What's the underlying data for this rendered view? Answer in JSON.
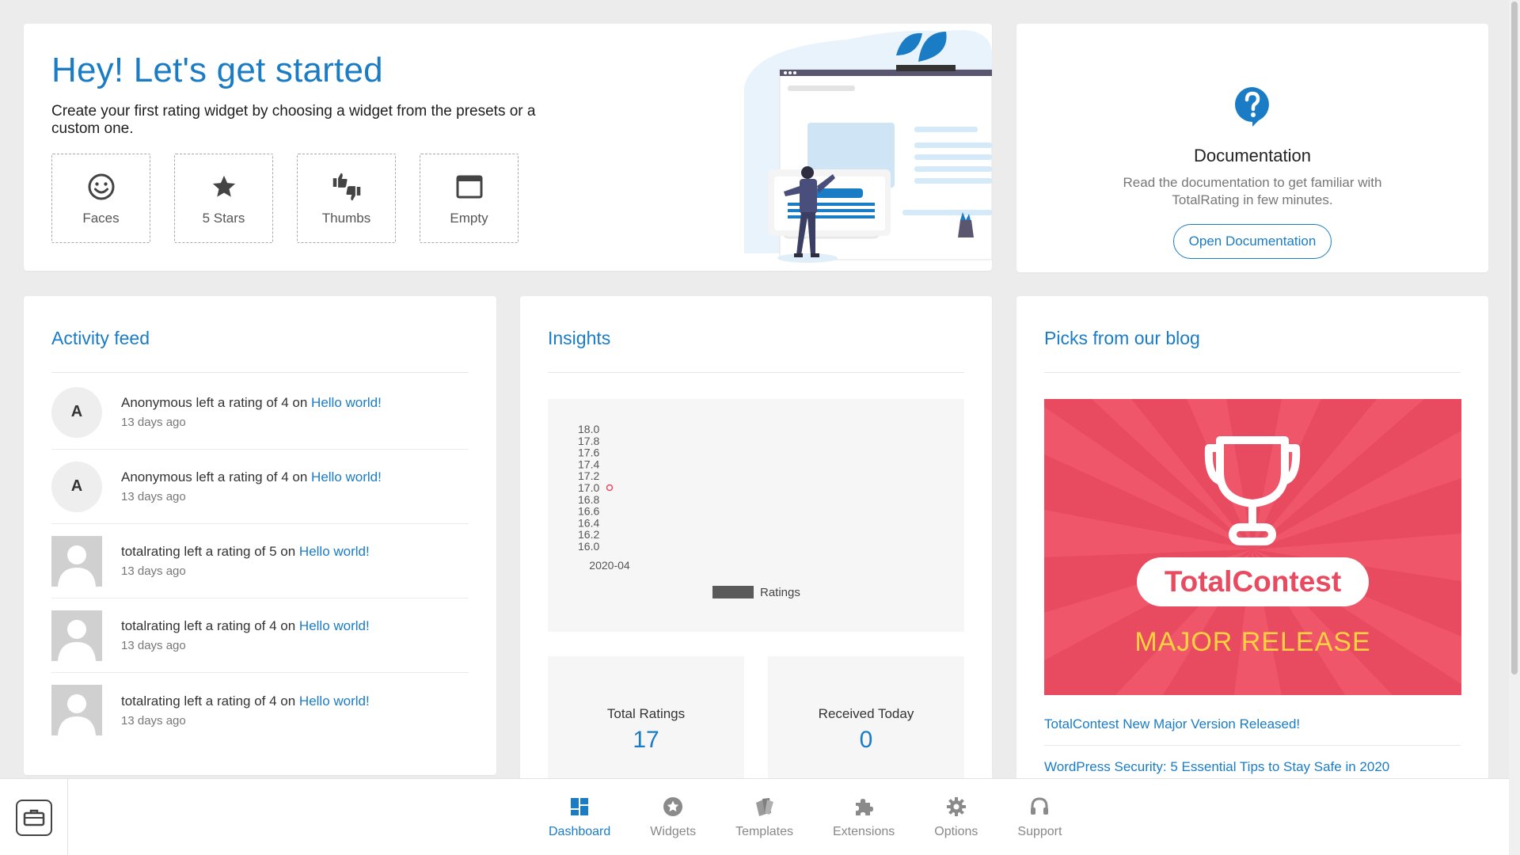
{
  "hero": {
    "title": "Hey! Let's get started",
    "subtitle": "Create your first rating widget by choosing a widget from the presets or a custom one.",
    "presets": [
      {
        "label": "Faces",
        "icon": "smiley-face-icon"
      },
      {
        "label": "5 Stars",
        "icon": "star-icon"
      },
      {
        "label": "Thumbs",
        "icon": "thumbs-icon"
      },
      {
        "label": "Empty",
        "icon": "window-icon"
      }
    ]
  },
  "docs": {
    "icon": "question-icon",
    "title": "Documentation",
    "description": "Read the documentation to get familiar with TotalRating in few minutes.",
    "button_label": "Open Documentation"
  },
  "activity": {
    "title": "Activity feed",
    "items": [
      {
        "avatar": "A",
        "text": "Anonymous left a rating of 4 on ",
        "link": "Hello world!",
        "time": "13 days ago"
      },
      {
        "avatar": "A",
        "text": "Anonymous left a rating of 4 on ",
        "link": "Hello world!",
        "time": "13 days ago"
      },
      {
        "avatar": "",
        "text": "totalrating left a rating of 5 on ",
        "link": "Hello world!",
        "time": "13 days ago"
      },
      {
        "avatar": "",
        "text": "totalrating left a rating of 4 on ",
        "link": "Hello world!",
        "time": "13 days ago"
      },
      {
        "avatar": "",
        "text": "totalrating left a rating of 4 on ",
        "link": "Hello world!",
        "time": "13 days ago"
      }
    ]
  },
  "insights": {
    "title": "Insights",
    "stats": [
      {
        "label": "Total Ratings",
        "value": "17"
      },
      {
        "label": "Received Today",
        "value": "0"
      }
    ]
  },
  "chart_data": {
    "type": "line",
    "x": [
      "2020-04"
    ],
    "series": [
      {
        "name": "Ratings",
        "values": [
          17.0
        ],
        "color": "#e84a5f"
      }
    ],
    "yticks": [
      "18.0",
      "17.8",
      "17.6",
      "17.4",
      "17.2",
      "17.0",
      "16.8",
      "16.6",
      "16.4",
      "16.2",
      "16.0"
    ],
    "ylim": [
      16.0,
      18.0
    ],
    "legend": "bottom",
    "legend_color": "#5a5a5a"
  },
  "blog": {
    "title": "Picks from our blog",
    "banner": {
      "brand": "TotalContest",
      "tagline": "MAJOR RELEASE",
      "bg": "#e84a5f",
      "accent": "#ffd23f"
    },
    "links": [
      "TotalContest New Major Version Released!",
      "WordPress Security: 5 Essential Tips to Stay Safe in 2020"
    ]
  },
  "nav": {
    "items": [
      {
        "label": "Dashboard",
        "icon": "dashboard-icon",
        "active": true
      },
      {
        "label": "Widgets",
        "icon": "widgets-star-icon",
        "active": false
      },
      {
        "label": "Templates",
        "icon": "templates-icon",
        "active": false
      },
      {
        "label": "Extensions",
        "icon": "puzzle-icon",
        "active": false
      },
      {
        "label": "Options",
        "icon": "gear-icon",
        "active": false
      },
      {
        "label": "Support",
        "icon": "headphones-icon",
        "active": false
      }
    ]
  },
  "colors": {
    "accent": "#1a7cc4",
    "background": "#ececec"
  }
}
